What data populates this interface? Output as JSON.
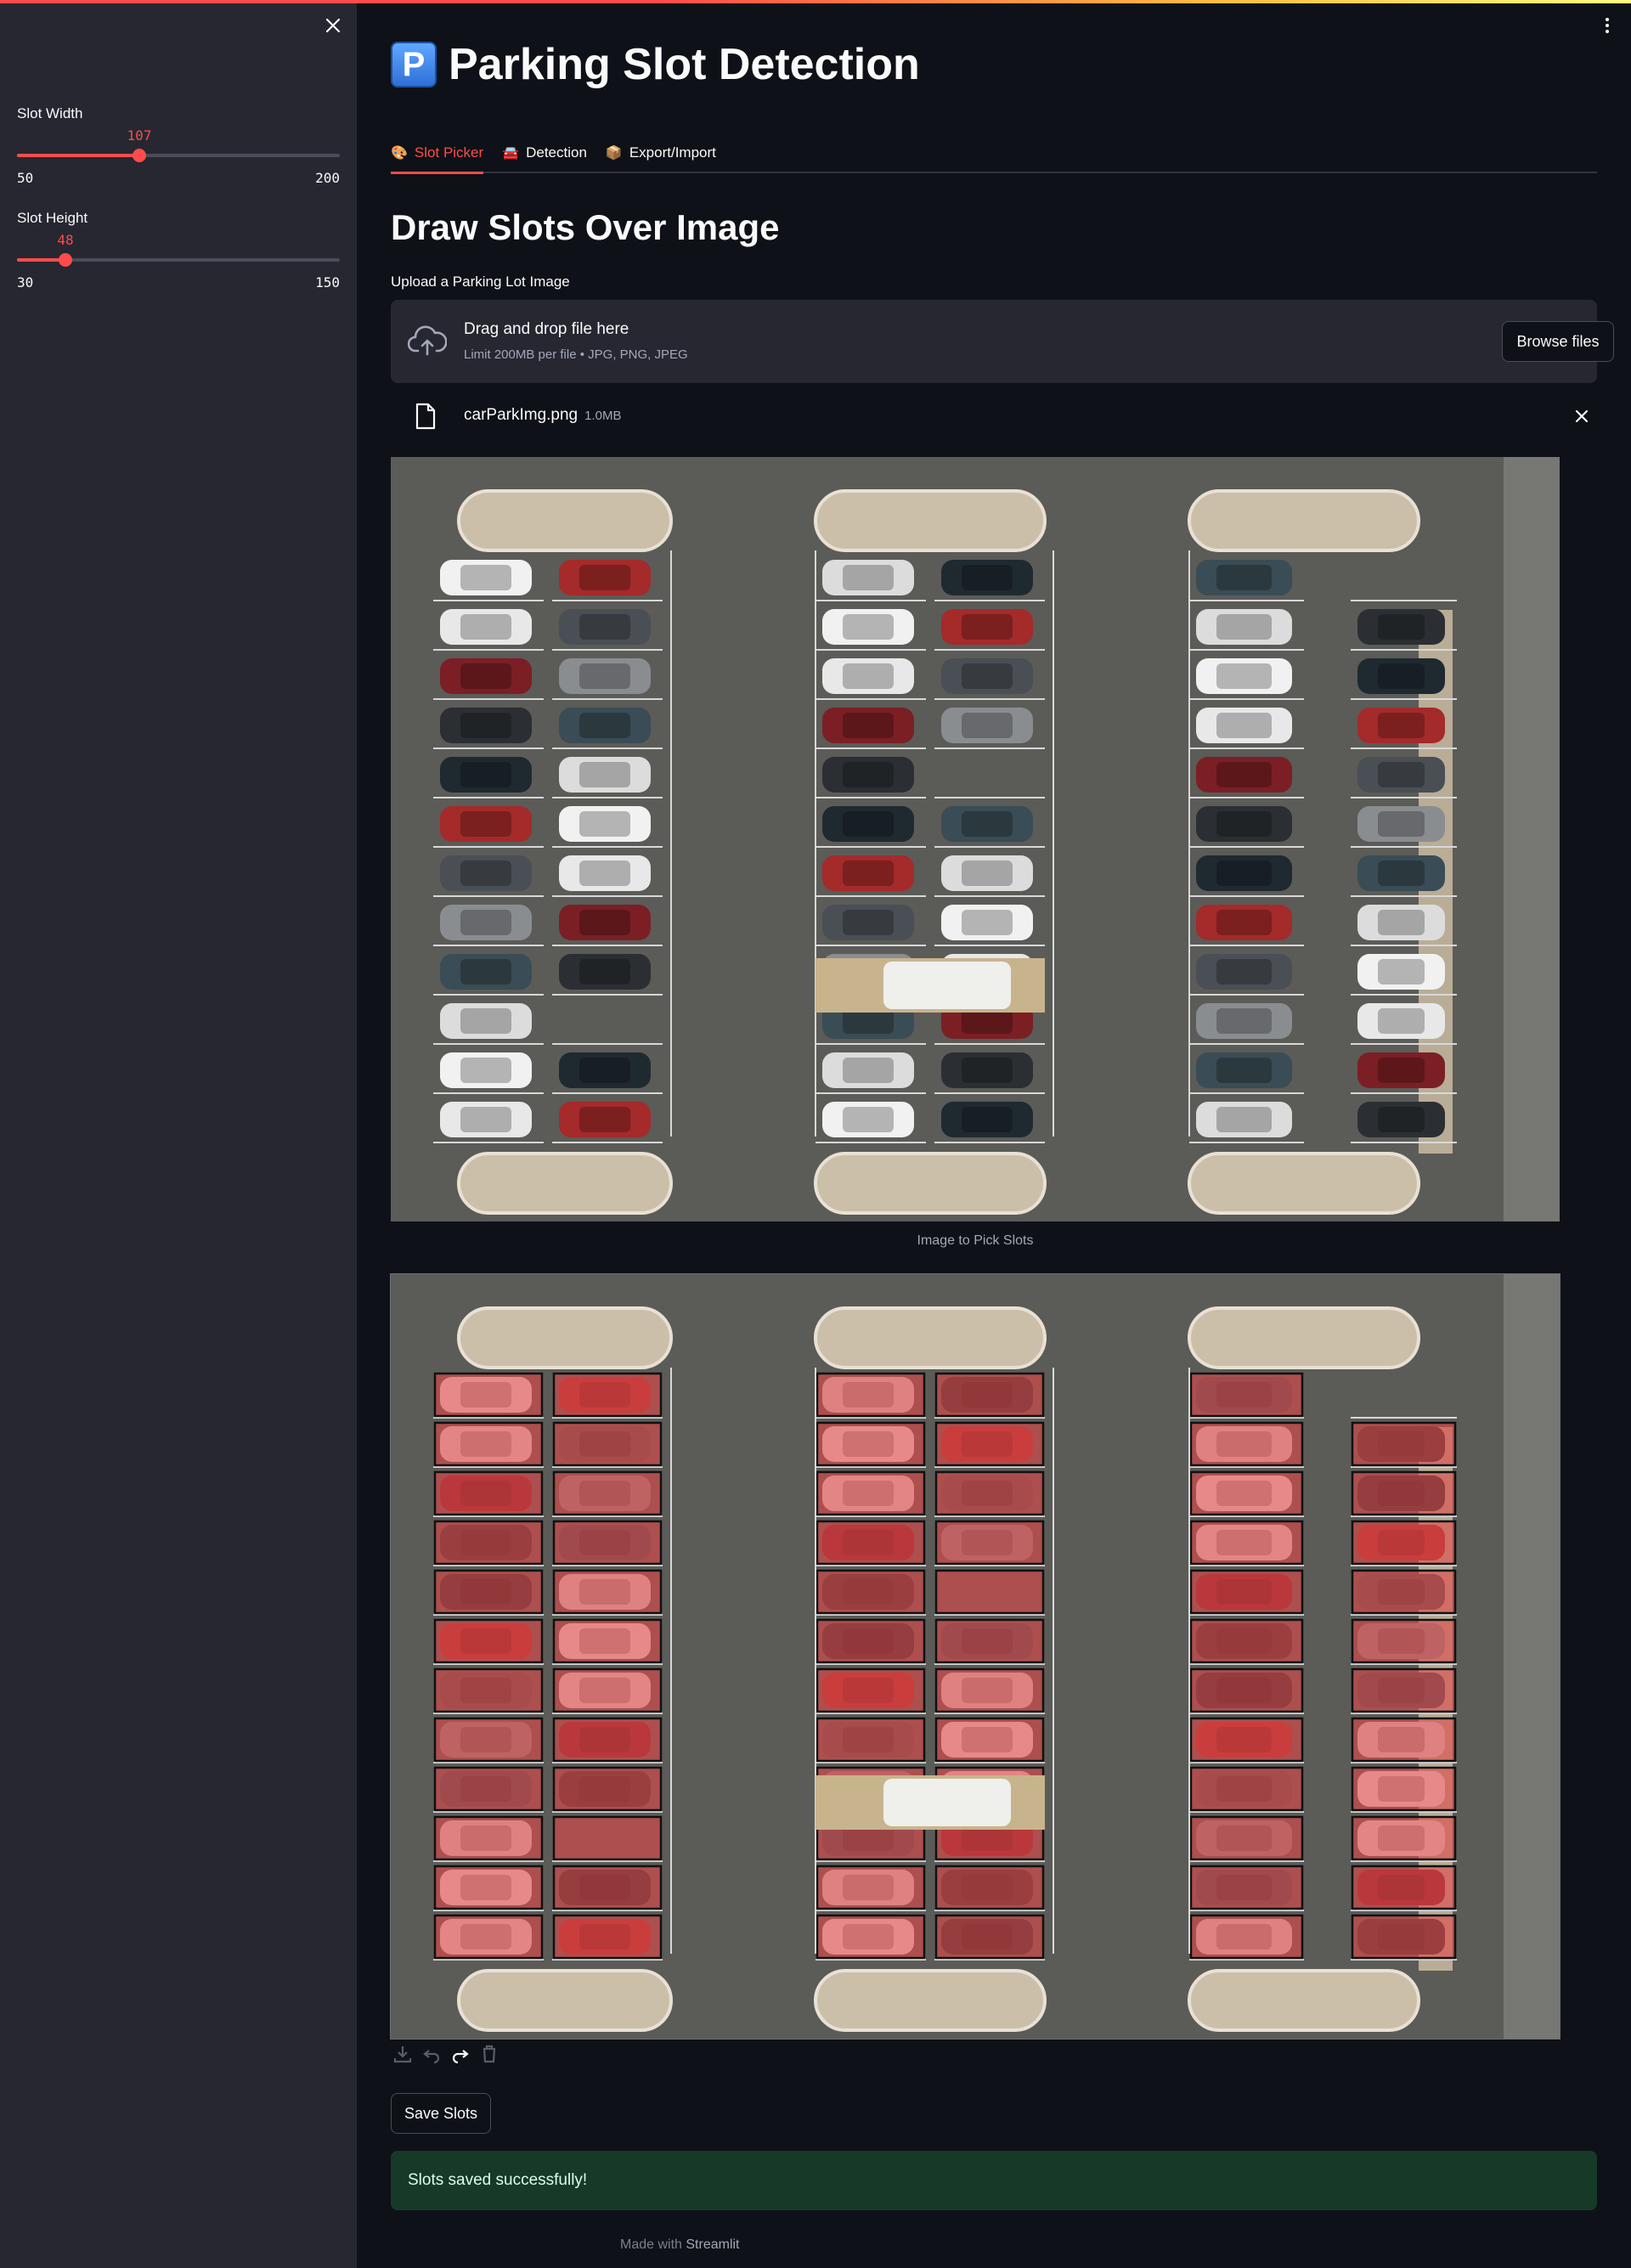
{
  "sidebar": {
    "close_icon": "close-icon",
    "sliders": [
      {
        "label": "Slot Width",
        "value": "107",
        "min": "50",
        "max": "200",
        "fraction": 0.38
      },
      {
        "label": "Slot Height",
        "value": "48",
        "min": "30",
        "max": "150",
        "fraction": 0.15
      }
    ]
  },
  "header": {
    "icon_letter": "P",
    "title": "Parking Slot Detection",
    "menu_icon": "vertical-dots-icon"
  },
  "tabs": [
    {
      "icon": "🎨",
      "label": "Slot Picker",
      "active": true
    },
    {
      "icon": "🚘",
      "label": "Detection",
      "active": false
    },
    {
      "icon": "📦",
      "label": "Export/Import",
      "active": false
    }
  ],
  "main": {
    "section_title": "Draw Slots Over Image",
    "upload_label": "Upload a Parking Lot Image",
    "dropzone": {
      "title": "Drag and drop file here",
      "subtitle": "Limit 200MB per file • JPG, PNG, JPEG",
      "browse_label": "Browse files"
    },
    "file": {
      "name": "carParkImg.png",
      "size": "1.0MB"
    },
    "image_caption": "Image to Pick Slots",
    "save_label": "Save Slots",
    "success_message": "Slots saved successfully!",
    "footer_prefix": "Made with",
    "footer_brand": "Streamlit"
  },
  "colors": {
    "accent": "#ff4b4b",
    "background": "#0e1117",
    "sidebar": "#262730",
    "success_bg": "#173928",
    "slot_fill": "#e04848"
  }
}
